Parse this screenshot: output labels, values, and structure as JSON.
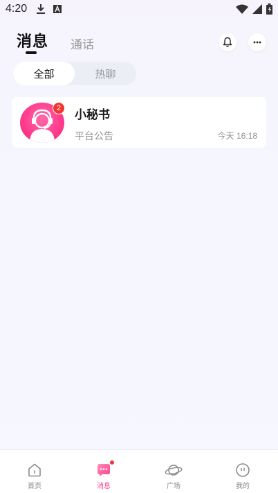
{
  "status_bar": {
    "time": "4:20",
    "icons": [
      "download-icon",
      "a-box-icon",
      "wifi-icon",
      "signal-icon",
      "battery-icon"
    ]
  },
  "header": {
    "tabs": [
      {
        "label": "消息",
        "active": true
      },
      {
        "label": "通话",
        "active": false
      }
    ],
    "actions": [
      "bell-icon",
      "more-icon"
    ]
  },
  "filter": {
    "options": [
      {
        "label": "全部",
        "selected": true
      },
      {
        "label": "热聊",
        "selected": false
      }
    ]
  },
  "conversations": [
    {
      "name": "小秘书",
      "preview": "平台公告",
      "time": "今天 16:18",
      "unread": "2",
      "avatar": "headset-user-icon"
    }
  ],
  "bottom_nav": {
    "items": [
      {
        "label": "首页",
        "icon": "home-icon",
        "active": false
      },
      {
        "label": "消息",
        "icon": "chat-icon",
        "active": true,
        "dot": true
      },
      {
        "label": "广场",
        "icon": "planet-icon",
        "active": false
      },
      {
        "label": "我的",
        "icon": "profile-icon",
        "active": false
      }
    ]
  },
  "colors": {
    "accent": "#ff3f8f",
    "badge": "#f2362f",
    "background": "#f6f7ff"
  }
}
